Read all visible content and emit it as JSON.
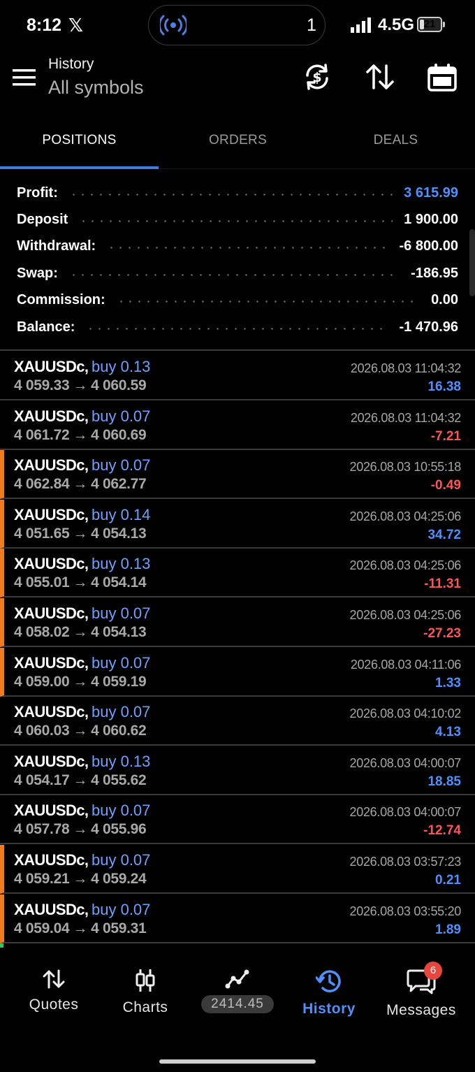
{
  "status_bar": {
    "time": "8:12",
    "x_logo": "𝕏",
    "notification_count": "1",
    "network": "4.5G",
    "battery": "21",
    "battery_level": 0.21
  },
  "header": {
    "subtitle": "History",
    "title": "All symbols"
  },
  "tabs": [
    {
      "label": "POSITIONS",
      "active": true
    },
    {
      "label": "ORDERS",
      "active": false
    },
    {
      "label": "DEALS",
      "active": false
    }
  ],
  "summary": [
    {
      "label": "Profit:",
      "value": "3 615.99",
      "color": "#4f90ff"
    },
    {
      "label": "Deposit",
      "value": "1 900.00"
    },
    {
      "label": "Withdrawal:",
      "value": "-6 800.00"
    },
    {
      "label": "Swap:",
      "value": "-186.95"
    },
    {
      "label": "Commission:",
      "value": "0.00"
    },
    {
      "label": "Balance:",
      "value": "-1 470.96"
    }
  ],
  "positions": [
    {
      "symbol": "XAUUSDc,",
      "side": "buy 0.13",
      "open": "4 059.33",
      "close": "4 060.59",
      "time": "2026.08.03 11:04:32",
      "profit": "16.38",
      "positive": true,
      "flag": false
    },
    {
      "symbol": "XAUUSDc,",
      "side": "buy 0.07",
      "open": "4 061.72",
      "close": "4 060.69",
      "time": "2026.08.03 11:04:32",
      "profit": "-7.21",
      "positive": false,
      "flag": false
    },
    {
      "symbol": "XAUUSDc,",
      "side": "buy 0.07",
      "open": "4 062.84",
      "close": "4 062.77",
      "time": "2026.08.03 10:55:18",
      "profit": "-0.49",
      "positive": false,
      "flag": true
    },
    {
      "symbol": "XAUUSDc,",
      "side": "buy 0.14",
      "open": "4 051.65",
      "close": "4 054.13",
      "time": "2026.08.03 04:25:06",
      "profit": "34.72",
      "positive": true,
      "flag": true
    },
    {
      "symbol": "XAUUSDc,",
      "side": "buy 0.13",
      "open": "4 055.01",
      "close": "4 054.14",
      "time": "2026.08.03 04:25:06",
      "profit": "-11.31",
      "positive": false,
      "flag": true
    },
    {
      "symbol": "XAUUSDc,",
      "side": "buy 0.07",
      "open": "4 058.02",
      "close": "4 054.13",
      "time": "2026.08.03 04:25:06",
      "profit": "-27.23",
      "positive": false,
      "flag": true
    },
    {
      "symbol": "XAUUSDc,",
      "side": "buy 0.07",
      "open": "4 059.00",
      "close": "4 059.19",
      "time": "2026.08.03 04:11:06",
      "profit": "1.33",
      "positive": true,
      "flag": true
    },
    {
      "symbol": "XAUUSDc,",
      "side": "buy 0.07",
      "open": "4 060.03",
      "close": "4 060.62",
      "time": "2026.08.03 04:10:02",
      "profit": "4.13",
      "positive": true,
      "flag": false
    },
    {
      "symbol": "XAUUSDc,",
      "side": "buy 0.13",
      "open": "4 054.17",
      "close": "4 055.62",
      "time": "2026.08.03 04:00:07",
      "profit": "18.85",
      "positive": true,
      "flag": false
    },
    {
      "symbol": "XAUUSDc,",
      "side": "buy 0.07",
      "open": "4 057.78",
      "close": "4 055.96",
      "time": "2026.08.03 04:00:07",
      "profit": "-12.74",
      "positive": false,
      "flag": false
    },
    {
      "symbol": "XAUUSDc,",
      "side": "buy 0.07",
      "open": "4 059.21",
      "close": "4 059.24",
      "time": "2026.08.03 03:57:23",
      "profit": "0.21",
      "positive": true,
      "flag": true
    },
    {
      "symbol": "XAUUSDc,",
      "side": "buy 0.07",
      "open": "4 059.04",
      "close": "4 059.31",
      "time": "2026.08.03 03:55:20",
      "profit": "1.89",
      "positive": true,
      "flag": true
    }
  ],
  "arrow_glyph": "→",
  "colors": {
    "accent": "#3d7ee6",
    "profit_positive": "#4f90ff",
    "profit_negative": "#ff5454",
    "flag_orange": "#f07b22",
    "badge_red": "#e8453c"
  },
  "bottom_nav": {
    "quotes": {
      "label": "Quotes",
      "icon": "quotes-arrows-icon"
    },
    "charts": {
      "label": "Charts",
      "icon": "candlestick-icon"
    },
    "trade": {
      "price": "2414.45",
      "icon": "trend-line-icon"
    },
    "history": {
      "label": "History",
      "icon": "history-clock-icon",
      "active": true
    },
    "messages": {
      "label": "Messages",
      "icon": "chat-bubbles-icon",
      "badge": "6"
    }
  }
}
